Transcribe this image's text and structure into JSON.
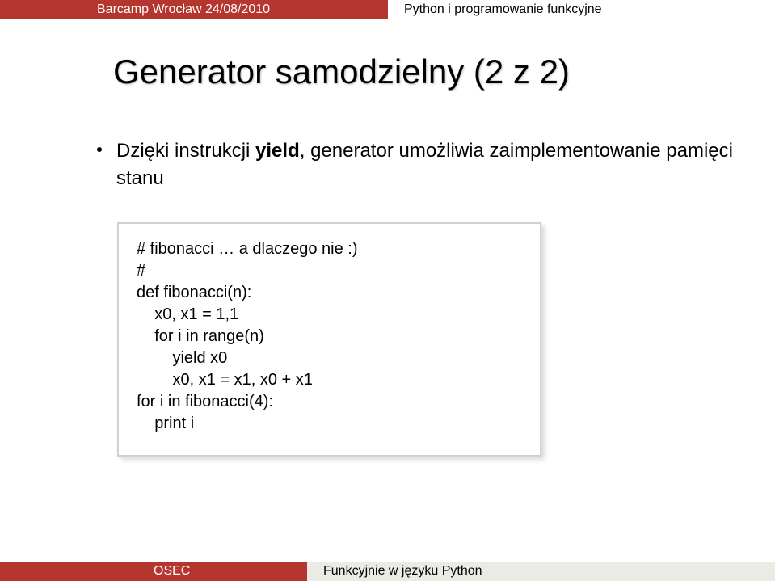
{
  "header": {
    "left": "Barcamp Wrocław 24/08/2010",
    "right": "Python i programowanie funkcyjne"
  },
  "slide": {
    "title": "Generator samodzielny (2 z 2)",
    "bullet_text_prefix": "Dzięki instrukcji ",
    "bullet_text_bold": "yield",
    "bullet_text_suffix": ", generator umożliwia zaimplementowanie pamięci stanu"
  },
  "code": {
    "l1": "# fibonacci … a dlaczego nie :)",
    "l2": "#",
    "l3": "def fibonacci(n):",
    "l4": "    x0, x1 = 1,1",
    "l5": "    for i in range(n)",
    "l6": "        yield x0",
    "l7": "        x0, x1 = x1, x0 + x1",
    "l8": "",
    "l9": "for i in fibonacci(4):",
    "l10": "    print i"
  },
  "footer": {
    "left": "OSEC",
    "right": "Funkcyjnie w języku Python"
  }
}
